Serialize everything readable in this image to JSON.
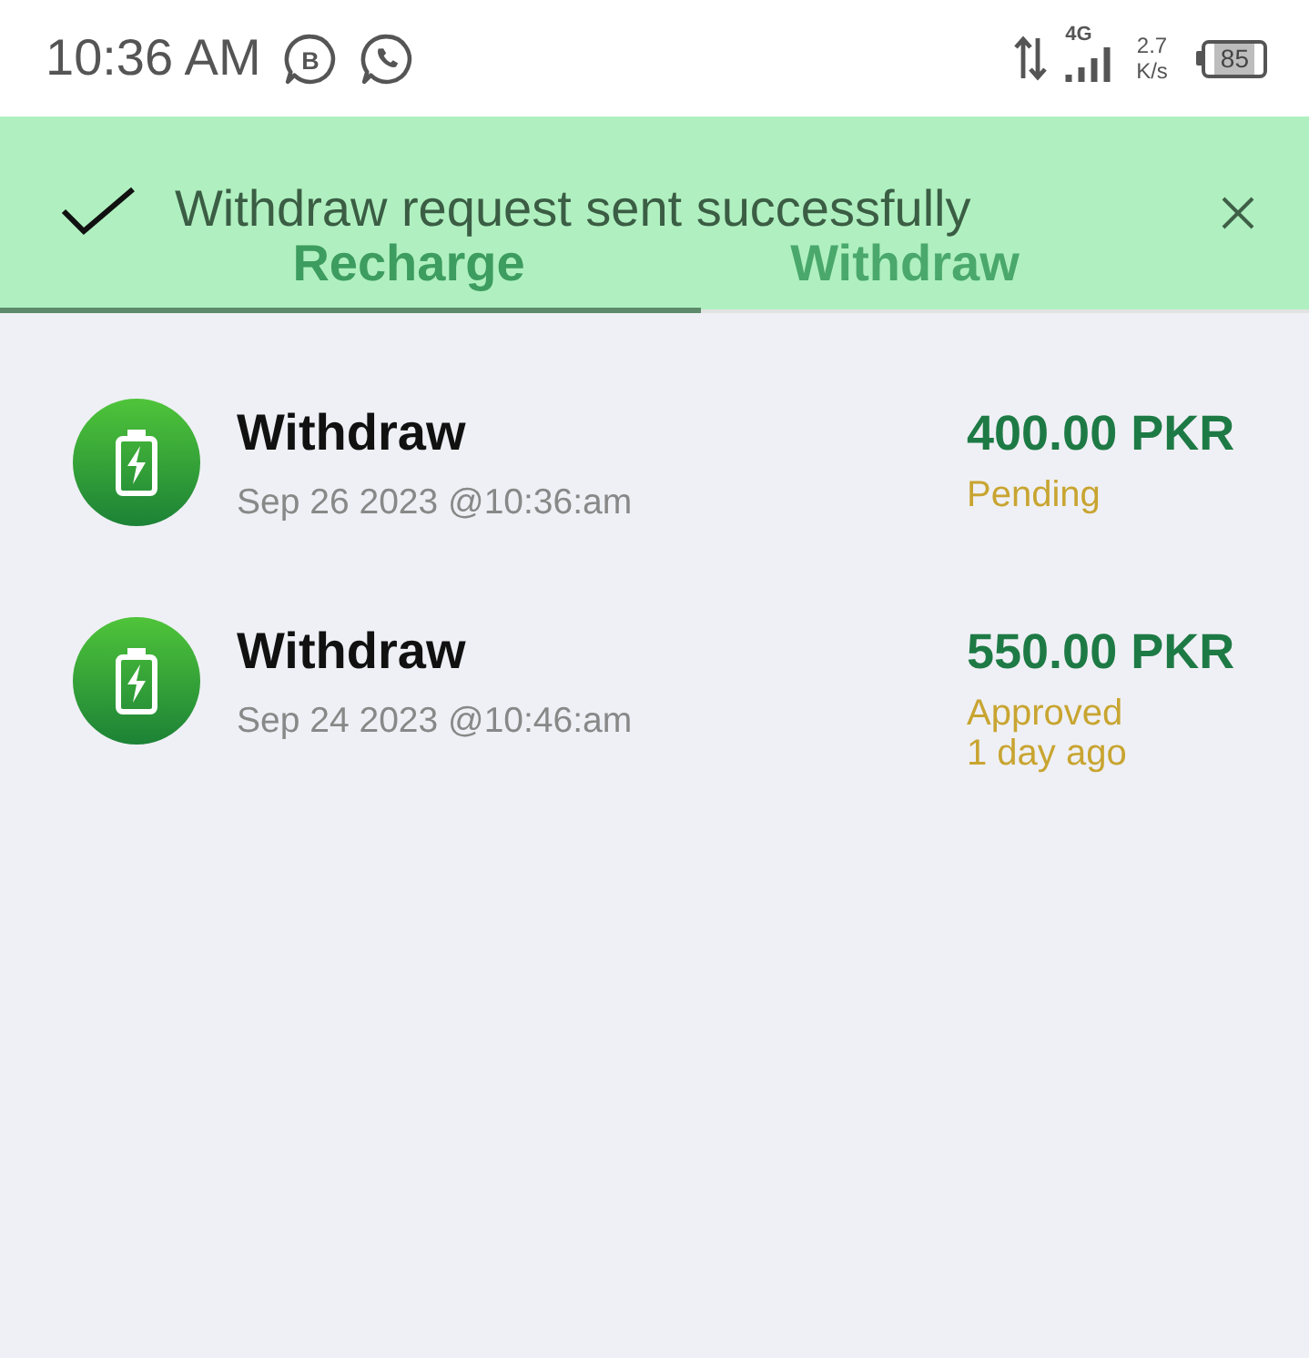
{
  "status_bar": {
    "time": "10:36 AM",
    "app_letter": "B",
    "network": "4G",
    "speed": "2.7",
    "speed_unit": "K/s",
    "battery": "85"
  },
  "tabs": [
    {
      "label": "Recharge",
      "selected": true
    },
    {
      "label": "Withdraw",
      "selected": false
    }
  ],
  "toast": {
    "message": "Withdraw request sent successfully"
  },
  "transactions": [
    {
      "title": "Withdraw",
      "date": "Sep 26 2023 @10:36:am",
      "amount": "400.00 PKR",
      "status": "Pending"
    },
    {
      "title": "Withdraw",
      "date": "Sep 24 2023 @10:46:am",
      "amount": "550.00 PKR",
      "status": "Approved",
      "note": "1 day ago"
    }
  ]
}
